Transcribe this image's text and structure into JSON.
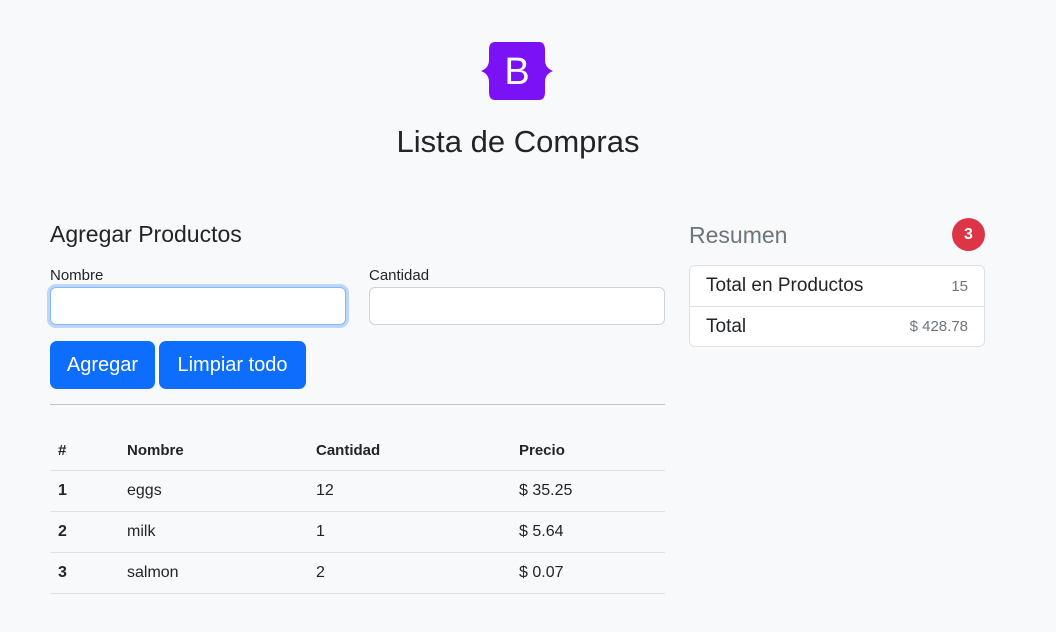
{
  "logo": {
    "letter": "B",
    "color": "#7a12f5"
  },
  "page_title": "Lista de Compras",
  "form": {
    "section_title": "Agregar Productos",
    "name_label": "Nombre",
    "name_value": "",
    "qty_label": "Cantidad",
    "qty_value": "",
    "add_button": "Agregar",
    "clear_button": "Limpiar todo"
  },
  "table": {
    "headers": [
      "#",
      "Nombre",
      "Cantidad",
      "Precio"
    ],
    "rows": [
      {
        "idx": "1",
        "name": "eggs",
        "qty": "12",
        "price": "$ 35.25"
      },
      {
        "idx": "2",
        "name": "milk",
        "qty": "1",
        "price": "$ 5.64"
      },
      {
        "idx": "3",
        "name": "salmon",
        "qty": "2",
        "price": "$ 0.07"
      }
    ]
  },
  "summary": {
    "title": "Resumen",
    "badge": "3",
    "items": [
      {
        "label": "Total en Productos",
        "value": "15"
      },
      {
        "label": "Total",
        "value": "$ 428.78"
      }
    ]
  },
  "colors": {
    "primary": "#0d6efd",
    "danger": "#dc3545",
    "muted": "#6c757d",
    "background": "#f8f9fa"
  }
}
